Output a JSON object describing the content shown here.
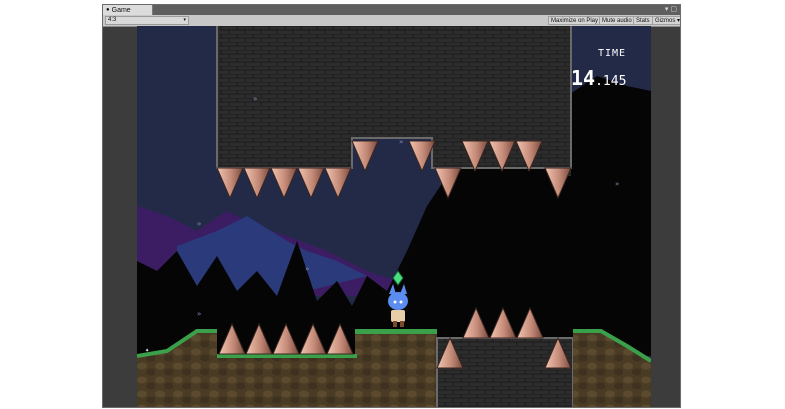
{
  "window": {
    "tab_label": "Game",
    "tab_icon": "unity-game-icon",
    "controls": "▾ ▢"
  },
  "toolbar": {
    "aspect_value": "4:3",
    "maximize_label": "Maximize on Play",
    "mute_label": "Mute audio",
    "stats_label": "Stats",
    "gizmos_label": "Gizmos ▾"
  },
  "hud": {
    "time_label": "TIME",
    "time_seconds": "14",
    "time_fraction": ".145"
  },
  "colors": {
    "sky": "#232a47",
    "mountain_purple": "#3c1d63",
    "mountain_blue": "#2a3a7a",
    "silhouette": "#050505",
    "brick": "#2c2c2c",
    "spike": "#c48a78",
    "grass": "#3aa04a",
    "dirt": "#4a3b24"
  }
}
